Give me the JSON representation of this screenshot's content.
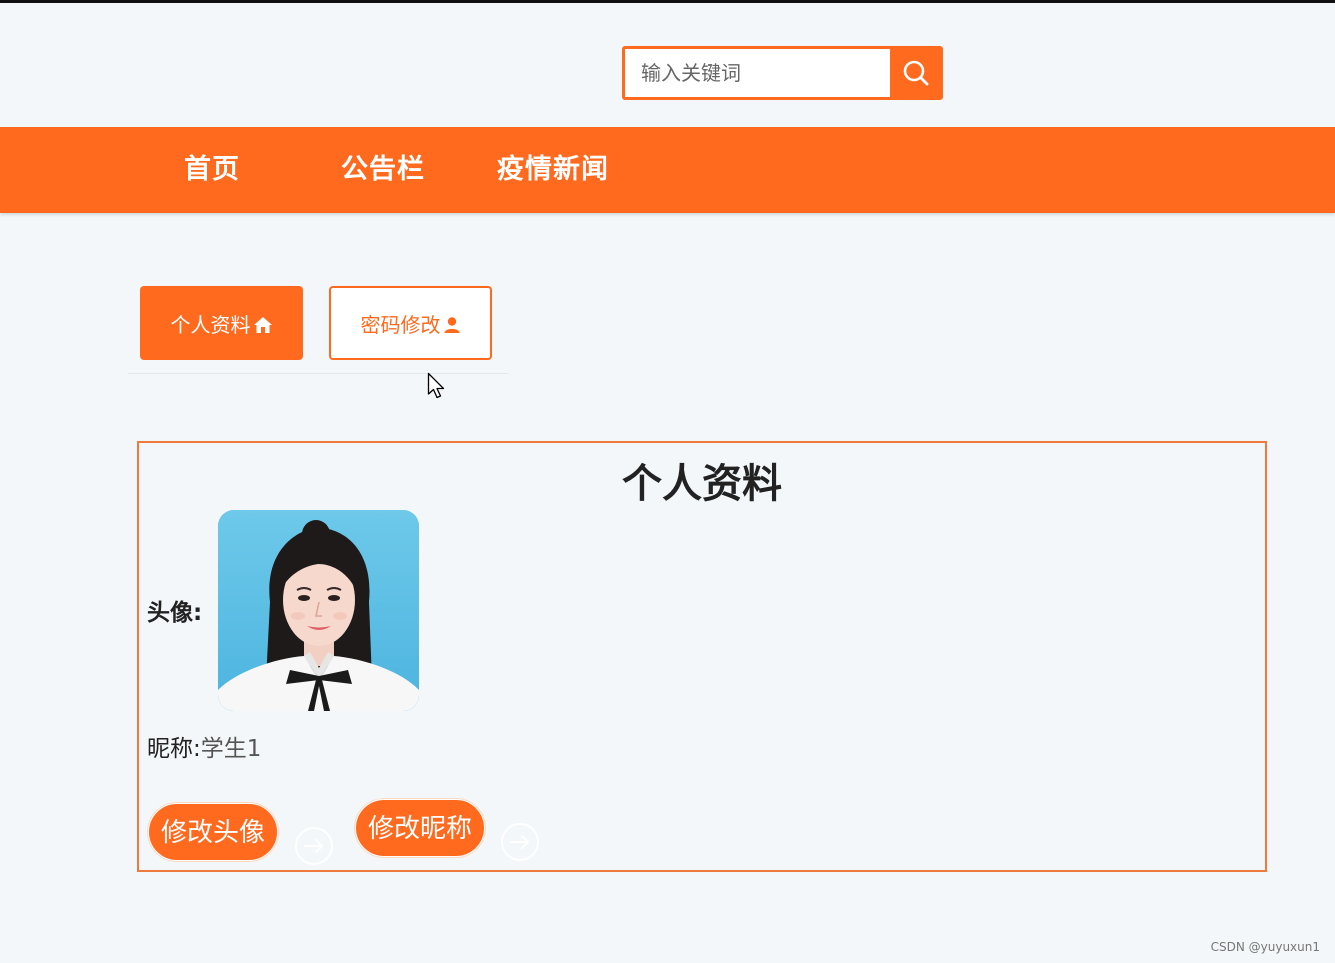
{
  "search": {
    "placeholder": "输入关键词",
    "icon": "search-icon"
  },
  "nav": {
    "items": [
      {
        "label": "首页"
      },
      {
        "label": "公告栏"
      },
      {
        "label": "疫情新闻"
      }
    ]
  },
  "tabs": {
    "profile": {
      "label": "个人资料",
      "icon": "home-icon",
      "active": true
    },
    "password": {
      "label": "密码修改",
      "icon": "user-icon",
      "active": false
    }
  },
  "profile": {
    "title": "个人资料",
    "avatar_label": "头像:",
    "nickname_label": "昵称:",
    "nickname_value": "学生1",
    "buttons": {
      "edit_avatar": "修改头像",
      "edit_nickname": "修改昵称"
    }
  },
  "watermark": "CSDN @yuyuxun1",
  "colors": {
    "accent": "#ff6a1f",
    "background": "#f3f7f9"
  }
}
